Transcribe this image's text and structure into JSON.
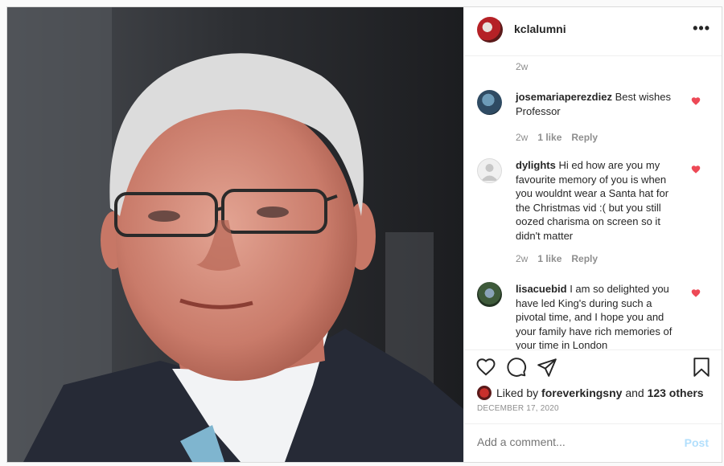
{
  "post": {
    "username": "kclalumni",
    "more_icon": "more-horizontal-icon"
  },
  "comments_top_time": "2w",
  "comments": [
    {
      "user": "josemariaperezdiez",
      "text": "Best wishes Professor",
      "time": "2w",
      "likes": "1 like",
      "reply": "Reply"
    },
    {
      "user": "dylights",
      "text": "Hi ed how are you my favourite memory of you is when you wouldnt wear a Santa hat for the Christmas vid :( but you still oozed charisma on screen so it didn't matter",
      "time": "2w",
      "likes": "1 like",
      "reply": "Reply"
    },
    {
      "user": "lisacuebid",
      "text": "I am so delighted you have led King's during such a pivotal time, and I hope you and your family have rich memories of your time in London",
      "time": "",
      "likes": "",
      "reply": ""
    }
  ],
  "likes": {
    "prefix": "Liked by",
    "user": "foreverkingsny",
    "joiner": "and",
    "others": "123 others"
  },
  "date": "DECEMBER 17, 2020",
  "add_comment": {
    "placeholder": "Add a comment...",
    "post_label": "Post"
  },
  "colors": {
    "heart": "#ed4956",
    "post_disabled": "#b2dffc",
    "muted": "#8e8e8e"
  }
}
